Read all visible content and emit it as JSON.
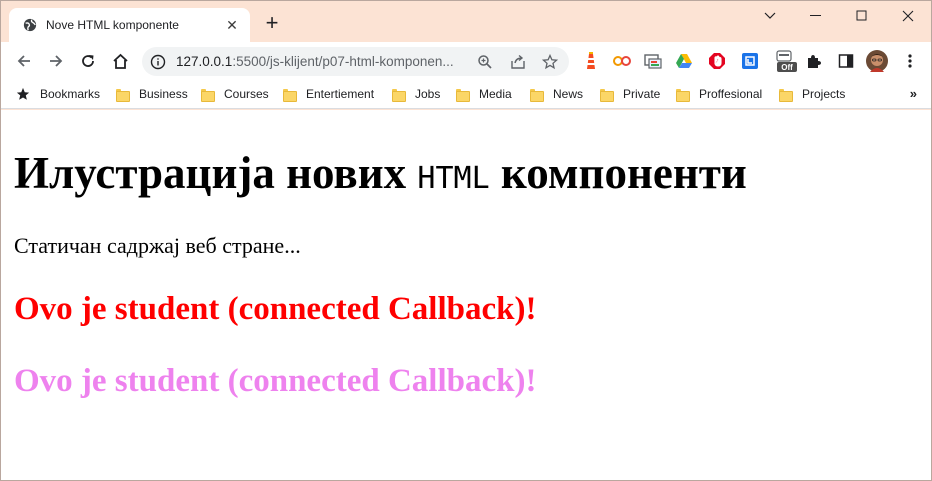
{
  "tab": {
    "title": "Nove HTML komponente"
  },
  "omnibox": {
    "host": "127.0.0.1",
    "path": ":5500/js-klijent/p07-html-komponen..."
  },
  "bookmarks": {
    "label": "Bookmarks",
    "folders": [
      "Business",
      "Courses",
      "Entertiement",
      "Jobs",
      "Media",
      "News",
      "Private",
      "Proffesional",
      "Projects"
    ],
    "more": "»"
  },
  "extensions": {
    "off_badge": "Off"
  },
  "page": {
    "heading_before": "Илустрација нових ",
    "heading_code": "HTML",
    "heading_after": " компоненти",
    "static_text": "Статичан садржај веб стране...",
    "student_text_1": "Ovo je student (connected Callback)!",
    "student_text_2": "Ovo je student (connected Callback)!"
  },
  "colors": {
    "titlebar": "#fce3d4",
    "student_1": "#ff0000",
    "student_2": "#ee82ee"
  },
  "icons": [
    "globe-icon",
    "close-icon",
    "plus-icon",
    "chevron-down-icon",
    "minimize-icon",
    "maximize-icon",
    "window-close-icon",
    "back-icon",
    "forward-icon",
    "reload-icon",
    "home-icon",
    "info-icon",
    "zoom-icon",
    "share-icon",
    "star-icon",
    "puzzle-icon",
    "sidepanel-icon",
    "menu-icon"
  ]
}
